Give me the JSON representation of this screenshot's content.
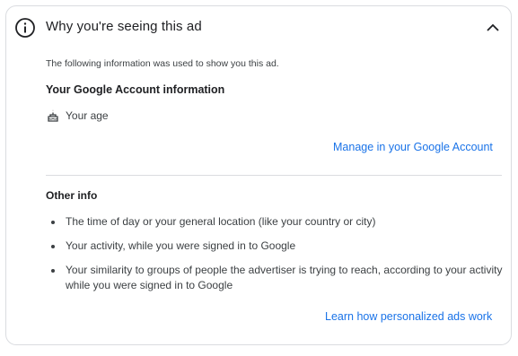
{
  "header": {
    "title": "Why you're seeing this ad",
    "info_icon": "info-icon",
    "collapse_icon": "chevron-up-icon"
  },
  "intro": "The following information was used to show you this ad.",
  "account_section": {
    "title": "Your Google Account information",
    "items": [
      {
        "icon": "cake-icon",
        "label": "Your age"
      }
    ],
    "link": "Manage in your Google Account"
  },
  "other_section": {
    "title": "Other info",
    "items": [
      "The time of day or your general location (like your country or city)",
      "Your activity, while you were signed in to Google",
      "Your similarity to groups of people the advertiser is trying to reach, according to your activity while you were signed in to Google"
    ],
    "link": "Learn how personalized ads work"
  },
  "colors": {
    "link": "#1a73e8",
    "text": "#202124",
    "secondary_text": "#3c4043",
    "border": "#dadce0"
  }
}
